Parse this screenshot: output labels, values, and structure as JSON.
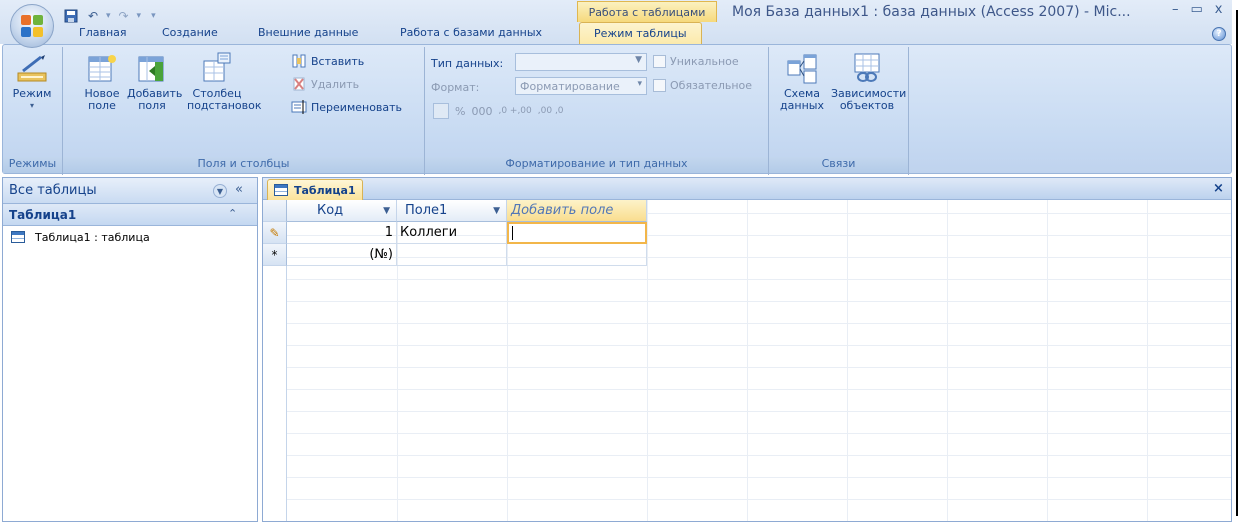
{
  "title_bar": {
    "context_group": "Работа с таблицами",
    "window_title": "Моя База данных1 : база данных (Access 2007) - Mic...",
    "controls": {
      "minimize": "–",
      "restore": "▭",
      "close": "x"
    }
  },
  "tabs": [
    "Главная",
    "Создание",
    "Внешние данные",
    "Работа с базами данных",
    "Режим таблицы"
  ],
  "active_tab": "Режим таблицы",
  "ribbon": {
    "views": {
      "button": "Режим",
      "group_label": "Режимы"
    },
    "fields_columns": {
      "new_field": "Новое поле",
      "new_field_l1": "Новое",
      "new_field_l2": "поле",
      "add_fields_l1": "Добавить",
      "add_fields_l2": "поля",
      "lookup_l1": "Столбец",
      "lookup_l2": "подстановок",
      "insert": "Вставить",
      "delete": "Удалить",
      "rename": "Переименовать",
      "group_label": "Поля и столбцы"
    },
    "format": {
      "data_type_label": "Тип данных:",
      "data_type_value": "",
      "format_label": "Формат:",
      "format_value": "Форматирование",
      "unique": "Уникальное",
      "required": "Обязательное",
      "percent": "%",
      "thousands": "000",
      "group_label": "Форматирование и тип данных"
    },
    "relationships": {
      "schema_l1": "Схема",
      "schema_l2": "данных",
      "deps_l1": "Зависимости",
      "deps_l2": "объектов",
      "group_label": "Связи"
    }
  },
  "nav_pane": {
    "header": "Все таблицы",
    "group": "Таблица1",
    "items": [
      {
        "label": "Таблица1 : таблица"
      }
    ]
  },
  "document": {
    "tab": "Таблица1",
    "close": "×",
    "columns": [
      "Код",
      "Поле1",
      "Добавить поле"
    ],
    "rows": [
      {
        "selector": "✎",
        "id": "1",
        "field1": "Коллеги"
      },
      {
        "selector": "*",
        "id": "(№)",
        "field1": ""
      }
    ]
  },
  "colors": {
    "ribbon_bg": "#c7daf2",
    "accent_highlight": "#f9dd8f",
    "text_blue": "#15428b"
  }
}
